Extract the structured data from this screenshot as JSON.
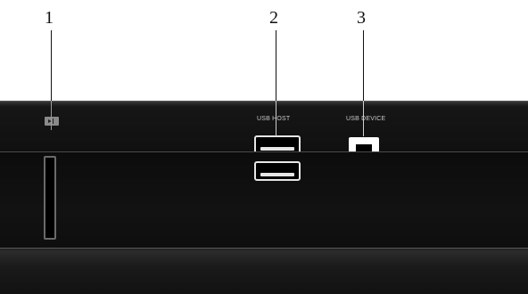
{
  "callouts": [
    "1",
    "2",
    "3"
  ],
  "labels": {
    "usb_host": "USB HOST",
    "usb_device": "USB DEVICE"
  },
  "icons": {
    "card_reader": "sd-card-icon",
    "usb_host": "usb-a-port-icon",
    "usb_device": "usb-b-port-icon"
  },
  "colors": {
    "device_body": "#111111",
    "port_outline": "#e6e6e6",
    "label_text": "#c8c8c8"
  }
}
